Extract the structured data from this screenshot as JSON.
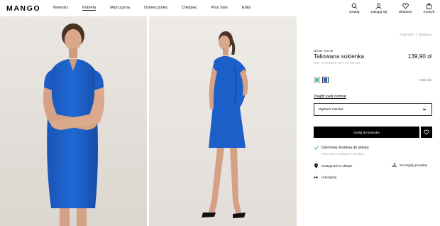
{
  "brand": {
    "logo": "MANGO"
  },
  "nav": [
    "Nowości",
    "Kobieta",
    "Mężczyzna",
    "Dziewczynka",
    "Chłopiec",
    "Plus Size",
    "Edits"
  ],
  "nav_active": "Kobieta",
  "header_actions": {
    "search": "Szukaj",
    "login": "Zaloguj się",
    "favorites": "Ulubione",
    "cart": "Koszyk"
  },
  "breadcrumb": [
    "Poprzedni",
    "Następny"
  ],
  "product": {
    "badge": "NEW NOW",
    "title": "Taliowana sukienka",
    "price": "139,90 zł",
    "ref": "REF. 67005000-COTTAI-MLAM",
    "color_name": "Niebieski",
    "colors": [
      "#5fb6b9",
      "#1f5fbf"
    ]
  },
  "size": {
    "guide_link": "Znajdź swój rozmiar",
    "placeholder": "Wybierz rozmiar"
  },
  "actions": {
    "add_to_cart": "Dodaj do koszyka"
  },
  "delivery": {
    "title": "Darmowa dostawa do sklepu",
    "info": "Informacje o dostawie i zwrotach"
  },
  "links": {
    "availability": "Dostępność w sklepie",
    "details": "Szczegóły produktu",
    "share": "Udostępnij"
  },
  "colors": {
    "dress": "#1c5fc8",
    "dress_shadow": "#134a9e",
    "skin": "#d9a88a",
    "hair": "#4a3225"
  }
}
